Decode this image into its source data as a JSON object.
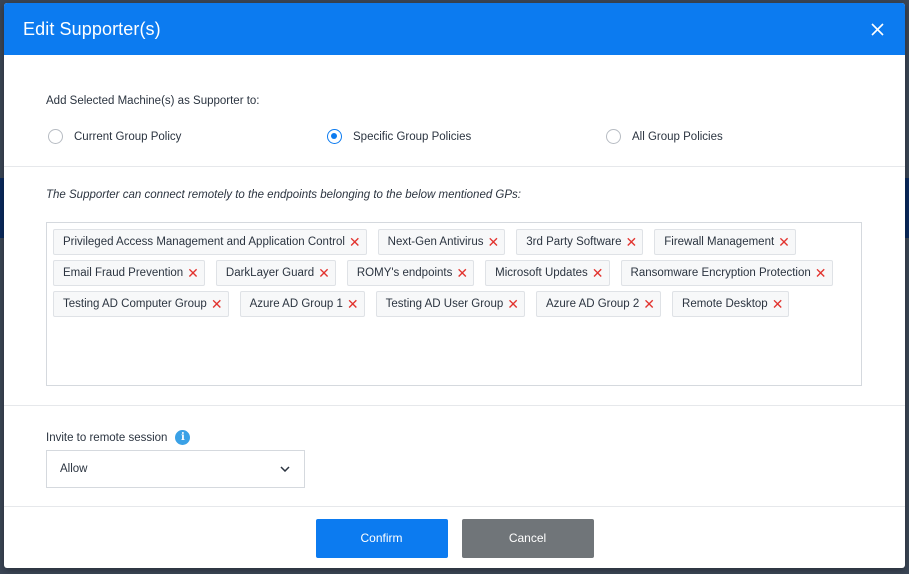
{
  "dialog": {
    "title": "Edit Supporter(s)"
  },
  "supporter_scope": {
    "label": "Add Selected Machine(s) as Supporter to:",
    "options": [
      {
        "label": "Current Group Policy",
        "selected": false
      },
      {
        "label": "Specific Group Policies",
        "selected": true
      },
      {
        "label": "All Group Policies",
        "selected": false
      }
    ]
  },
  "group_policies": {
    "description": "The Supporter can connect remotely to the endpoints belonging to the below mentioned GPs:",
    "tags": [
      "Privileged Access Management and Application Control",
      "Next-Gen Antivirus",
      "3rd Party Software",
      "Firewall Management",
      "Email Fraud Prevention",
      "DarkLayer Guard",
      "ROMY's endpoints",
      "Microsoft Updates",
      "Ransomware Encryption Protection",
      "Testing AD Computer Group",
      "Azure AD Group 1",
      "Testing AD User Group",
      "Azure AD Group 2",
      "Remote Desktop"
    ],
    "remove_glyph": "✕"
  },
  "invite": {
    "label": "Invite to remote session",
    "info_glyph": "i",
    "selected_value": "Allow"
  },
  "footer": {
    "confirm_label": "Confirm",
    "cancel_label": "Cancel"
  },
  "colors": {
    "accent": "#0c7bf0",
    "remove": "#e2342f",
    "cancel": "#707579",
    "info": "#3aa1e6"
  }
}
